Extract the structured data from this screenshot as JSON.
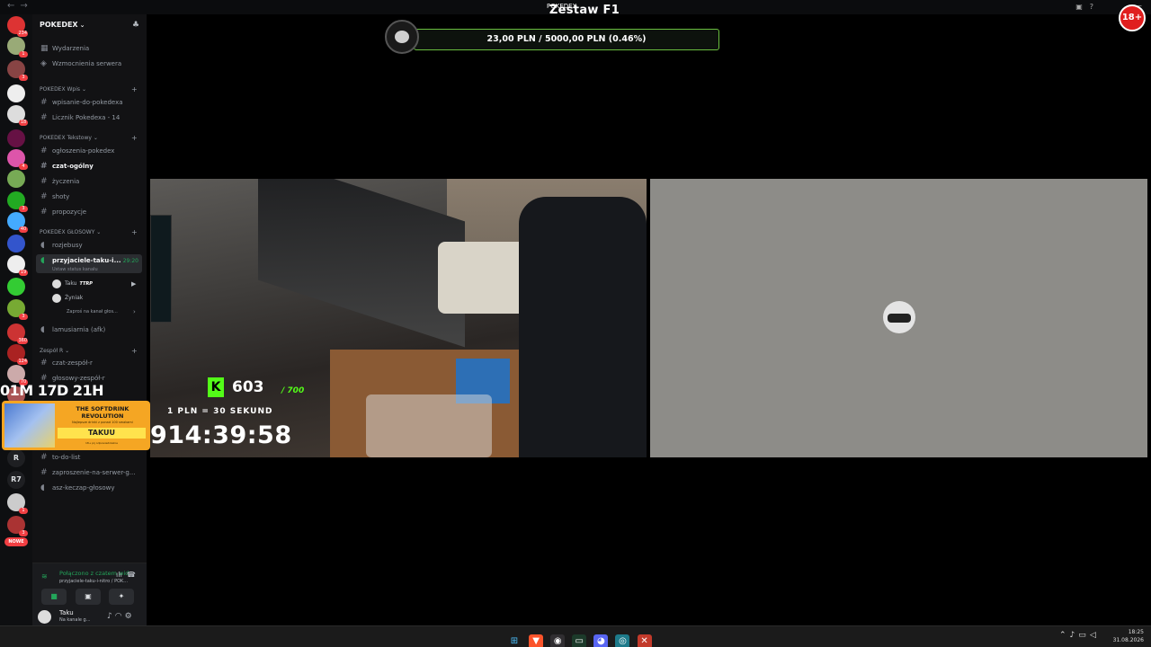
{
  "titlebar": {
    "back_icon": "arrow-left-icon",
    "forward_icon": "arrow-right-icon",
    "title": "POKEDEX"
  },
  "server_badges": [
    "234",
    "1",
    "3",
    "",
    "18",
    "",
    "4",
    "",
    "3",
    "40",
    "",
    "19",
    "",
    "3",
    "360",
    "124",
    "70",
    "190",
    "",
    "",
    "",
    "1",
    "3"
  ],
  "server_nowe": "NOWE",
  "server_text_icons": [
    "R",
    "R7"
  ],
  "guild": {
    "name": "POKEDEX"
  },
  "channels": {
    "top": [
      {
        "label": "Wydarzenia",
        "icon": "calendar-icon"
      },
      {
        "label": "Wzmocnienia serwera",
        "icon": "boost-icon"
      }
    ],
    "cat_wpis": "POKEDEX Wpis",
    "wpis": [
      {
        "label": "wpisanie-do-pokedexa"
      },
      {
        "label": "Licznik Pokedexa - 14"
      }
    ],
    "cat_tekst": "POKEDEX Tekstowy",
    "tekst": [
      {
        "label": "ogłoszenia-pokedex"
      },
      {
        "label": "czat-ogólny"
      },
      {
        "label": "życzenia"
      },
      {
        "label": "shoty"
      },
      {
        "label": "propozycje"
      }
    ],
    "cat_glos": "POKEDEX GŁOSOWY",
    "glos_first": "rozjebusy",
    "active_voice": "przyjaciele-taku-i...",
    "active_timer": "29:20",
    "active_status": "Ustaw status kanału",
    "voice_users": [
      {
        "name": "Taku",
        "tag": "TTRP"
      },
      {
        "name": "Żyniak",
        "tag": ""
      }
    ],
    "invite": "Zaproś na kanał głos...",
    "afk": "lamusiarnia (afk)",
    "cat_zespol": "Zespół R",
    "zespol": [
      {
        "label": "czat-zespół-r"
      },
      {
        "label": "głosowy-zespół-r"
      }
    ],
    "bottom": [
      {
        "label": "to-do-list"
      },
      {
        "label": "zaproszenie-na-serwer-g..."
      },
      {
        "label": "asz-keczap-głosowy"
      }
    ]
  },
  "voice_panel": {
    "title": "Połączono z czatem wid",
    "subtitle": "przyjaciele-taku-i-nitro / POK..."
  },
  "user_panel": {
    "name": "Taku",
    "status": "Na kanale g..."
  },
  "stream": {
    "title": "Zestaw F1",
    "goal_text": "23,00 PLN / 5000,00 PLN (0.46%)",
    "goal_fraction": 0.0046,
    "sub_count": "603",
    "sub_total": "/ 700",
    "rate_text": "1 PLN = 30 SEKUND",
    "clock": "914:39:58",
    "countdown": "01M 17D 21H",
    "ad": {
      "title": "THE SOFTDRINK REVOLUTION",
      "small": "Najlepsze drinki z ponad 100 smakami",
      "brand": "TAKUU",
      "foot": "18+ pij odpowiedzialnie"
    },
    "age_badge": "18+"
  },
  "taskbar": {
    "icons": [
      "windows-icon",
      "brave-icon",
      "obs-icon",
      "terminal-icon",
      "discord-icon",
      "edge-icon",
      "close-app-icon"
    ],
    "time": "18:25",
    "date": "31.08.2026"
  },
  "colors": {
    "accent_green": "#23a55a",
    "kick_green": "#53fc18",
    "badge_red": "#f23f43"
  }
}
